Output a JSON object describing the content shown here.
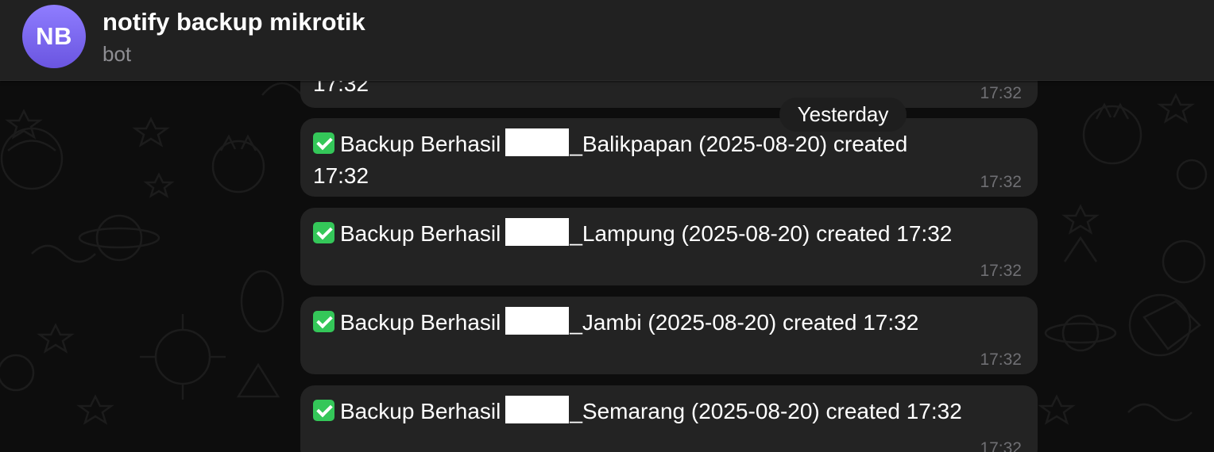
{
  "header": {
    "avatar_initials": "NB",
    "avatar_color": "#7b68ee",
    "title": "notify backup mikrotik",
    "subtitle": "bot"
  },
  "date_separator": "Yesterday",
  "check_icon_color": "#34c759",
  "messages": [
    {
      "prefix": "",
      "suffix": "",
      "last_line": "17:32",
      "time": "17:32"
    },
    {
      "prefix": "Backup Berhasil",
      "suffix": "_Balikpapan (2025-08-20) created",
      "last_line": "17:32",
      "time": "17:32"
    },
    {
      "prefix": "Backup Berhasil",
      "suffix": "_Lampung (2025-08-20) created 17:32",
      "last_line": "",
      "time": "17:32"
    },
    {
      "prefix": "Backup Berhasil",
      "suffix": "_Jambi (2025-08-20) created 17:32",
      "last_line": "",
      "time": "17:32"
    },
    {
      "prefix": "Backup Berhasil",
      "suffix": "_Semarang (2025-08-20) created 17:32",
      "last_line": "",
      "time": "17:32"
    }
  ]
}
